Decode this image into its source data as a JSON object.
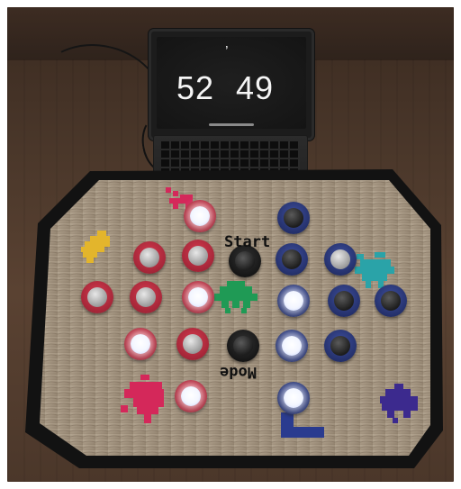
{
  "laptop": {
    "score_left": "52",
    "score_right": "49",
    "apostrophe": "’"
  },
  "board": {
    "label_start": "Start",
    "label_mode": "Mode"
  },
  "colors": {
    "red_button": "#c42a3e",
    "blue_button": "#2a377a",
    "invader_red": "#d4285a",
    "invader_yellow": "#e3b52c",
    "invader_teal": "#2aa3a8",
    "invader_green": "#1f9a55",
    "invader_purple": "#3c2a8e",
    "l_mark_blue": "#2a3b8f",
    "board_wood": "#a49581",
    "board_edge": "#121212"
  },
  "icons": [
    "space-invader-icon",
    "l-shape-mark"
  ]
}
